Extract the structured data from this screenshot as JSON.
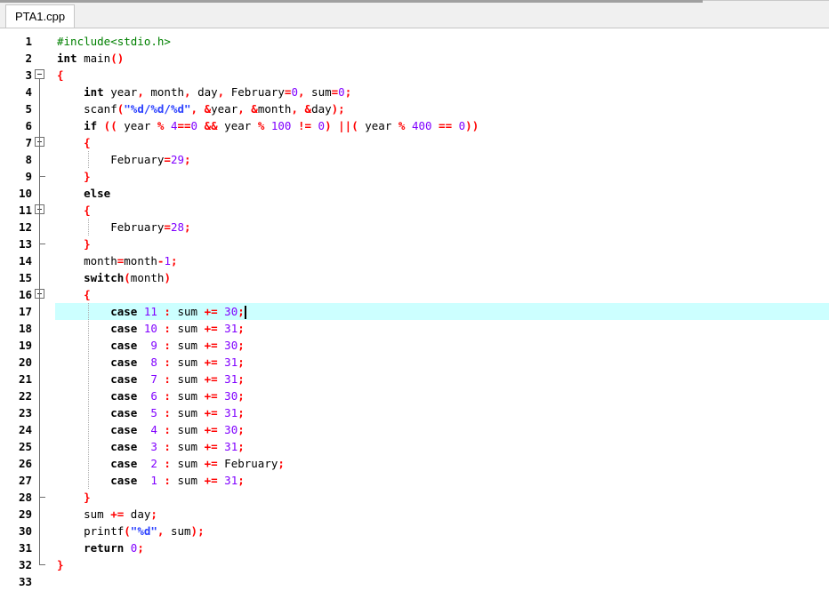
{
  "window": {
    "top_strip": true
  },
  "tab": {
    "label": "PTA1.cpp"
  },
  "editor": {
    "active_line": 17,
    "line_numbers": [
      "1",
      "2",
      "3",
      "4",
      "5",
      "6",
      "7",
      "8",
      "9",
      "10",
      "11",
      "12",
      "13",
      "14",
      "15",
      "16",
      "17",
      "18",
      "19",
      "20",
      "21",
      "22",
      "23",
      "24",
      "25",
      "26",
      "27",
      "28",
      "29",
      "30",
      "31",
      "32",
      "33"
    ],
    "lines": [
      [
        {
          "t": "#include<stdio.h>",
          "c": "pp"
        }
      ],
      [
        {
          "t": "int",
          "c": "kw"
        },
        {
          "t": " main",
          "c": "id"
        },
        {
          "t": "()",
          "c": "op"
        }
      ],
      [
        {
          "t": "{",
          "c": "op"
        }
      ],
      [
        {
          "t": "    int",
          "c": "kw"
        },
        {
          "t": " year",
          "c": "id"
        },
        {
          "t": ",",
          "c": "op"
        },
        {
          "t": " month",
          "c": "id"
        },
        {
          "t": ",",
          "c": "op"
        },
        {
          "t": " day",
          "c": "id"
        },
        {
          "t": ",",
          "c": "op"
        },
        {
          "t": " February",
          "c": "id"
        },
        {
          "t": "=",
          "c": "op"
        },
        {
          "t": "0",
          "c": "num"
        },
        {
          "t": ",",
          "c": "op"
        },
        {
          "t": " sum",
          "c": "id"
        },
        {
          "t": "=",
          "c": "op"
        },
        {
          "t": "0",
          "c": "num"
        },
        {
          "t": ";",
          "c": "op"
        }
      ],
      [
        {
          "t": "    scanf",
          "c": "id"
        },
        {
          "t": "(",
          "c": "op"
        },
        {
          "t": "\"%d/%d/%d\"",
          "c": "str"
        },
        {
          "t": ",",
          "c": "op"
        },
        {
          "t": " ",
          "c": "id"
        },
        {
          "t": "&",
          "c": "op"
        },
        {
          "t": "year",
          "c": "id"
        },
        {
          "t": ",",
          "c": "op"
        },
        {
          "t": " ",
          "c": "id"
        },
        {
          "t": "&",
          "c": "op"
        },
        {
          "t": "month",
          "c": "id"
        },
        {
          "t": ",",
          "c": "op"
        },
        {
          "t": " ",
          "c": "id"
        },
        {
          "t": "&",
          "c": "op"
        },
        {
          "t": "day",
          "c": "id"
        },
        {
          "t": ");",
          "c": "op"
        }
      ],
      [
        {
          "t": "    if",
          "c": "kw"
        },
        {
          "t": " ((",
          "c": "op"
        },
        {
          "t": " year ",
          "c": "id"
        },
        {
          "t": "%",
          "c": "op"
        },
        {
          "t": " 4",
          "c": "num"
        },
        {
          "t": "==",
          "c": "op"
        },
        {
          "t": "0",
          "c": "num"
        },
        {
          "t": " &&",
          "c": "op"
        },
        {
          "t": " year ",
          "c": "id"
        },
        {
          "t": "%",
          "c": "op"
        },
        {
          "t": " 100",
          "c": "num"
        },
        {
          "t": " !=",
          "c": "op"
        },
        {
          "t": " 0",
          "c": "num"
        },
        {
          "t": ")",
          "c": "op"
        },
        {
          "t": " ||(",
          "c": "op"
        },
        {
          "t": " year ",
          "c": "id"
        },
        {
          "t": "%",
          "c": "op"
        },
        {
          "t": " 400",
          "c": "num"
        },
        {
          "t": " ==",
          "c": "op"
        },
        {
          "t": " 0",
          "c": "num"
        },
        {
          "t": "))",
          "c": "op"
        }
      ],
      [
        {
          "t": "    {",
          "c": "op"
        }
      ],
      [
        {
          "t": "        February",
          "c": "id"
        },
        {
          "t": "=",
          "c": "op"
        },
        {
          "t": "29",
          "c": "num"
        },
        {
          "t": ";",
          "c": "op"
        }
      ],
      [
        {
          "t": "    }",
          "c": "op"
        }
      ],
      [
        {
          "t": "    else",
          "c": "kw"
        }
      ],
      [
        {
          "t": "    {",
          "c": "op"
        }
      ],
      [
        {
          "t": "        February",
          "c": "id"
        },
        {
          "t": "=",
          "c": "op"
        },
        {
          "t": "28",
          "c": "num"
        },
        {
          "t": ";",
          "c": "op"
        }
      ],
      [
        {
          "t": "    }",
          "c": "op"
        }
      ],
      [
        {
          "t": "    month",
          "c": "id"
        },
        {
          "t": "=",
          "c": "op"
        },
        {
          "t": "month",
          "c": "id"
        },
        {
          "t": "-",
          "c": "op"
        },
        {
          "t": "1",
          "c": "num"
        },
        {
          "t": ";",
          "c": "op"
        }
      ],
      [
        {
          "t": "    switch",
          "c": "kw"
        },
        {
          "t": "(",
          "c": "op"
        },
        {
          "t": "month",
          "c": "id"
        },
        {
          "t": ")",
          "c": "op"
        }
      ],
      [
        {
          "t": "    {",
          "c": "op"
        }
      ],
      [
        {
          "t": "        case",
          "c": "kw"
        },
        {
          "t": " 11",
          "c": "num"
        },
        {
          "t": " :",
          "c": "op"
        },
        {
          "t": " sum ",
          "c": "id"
        },
        {
          "t": "+=",
          "c": "op"
        },
        {
          "t": " 30",
          "c": "num"
        },
        {
          "t": ";",
          "c": "op"
        }
      ],
      [
        {
          "t": "        case",
          "c": "kw"
        },
        {
          "t": " 10",
          "c": "num"
        },
        {
          "t": " :",
          "c": "op"
        },
        {
          "t": " sum ",
          "c": "id"
        },
        {
          "t": "+=",
          "c": "op"
        },
        {
          "t": " 31",
          "c": "num"
        },
        {
          "t": ";",
          "c": "op"
        }
      ],
      [
        {
          "t": "        case",
          "c": "kw"
        },
        {
          "t": "  9",
          "c": "num"
        },
        {
          "t": " :",
          "c": "op"
        },
        {
          "t": " sum ",
          "c": "id"
        },
        {
          "t": "+=",
          "c": "op"
        },
        {
          "t": " 30",
          "c": "num"
        },
        {
          "t": ";",
          "c": "op"
        }
      ],
      [
        {
          "t": "        case",
          "c": "kw"
        },
        {
          "t": "  8",
          "c": "num"
        },
        {
          "t": " :",
          "c": "op"
        },
        {
          "t": " sum ",
          "c": "id"
        },
        {
          "t": "+=",
          "c": "op"
        },
        {
          "t": " 31",
          "c": "num"
        },
        {
          "t": ";",
          "c": "op"
        }
      ],
      [
        {
          "t": "        case",
          "c": "kw"
        },
        {
          "t": "  7",
          "c": "num"
        },
        {
          "t": " :",
          "c": "op"
        },
        {
          "t": " sum ",
          "c": "id"
        },
        {
          "t": "+=",
          "c": "op"
        },
        {
          "t": " 31",
          "c": "num"
        },
        {
          "t": ";",
          "c": "op"
        }
      ],
      [
        {
          "t": "        case",
          "c": "kw"
        },
        {
          "t": "  6",
          "c": "num"
        },
        {
          "t": " :",
          "c": "op"
        },
        {
          "t": " sum ",
          "c": "id"
        },
        {
          "t": "+=",
          "c": "op"
        },
        {
          "t": " 30",
          "c": "num"
        },
        {
          "t": ";",
          "c": "op"
        }
      ],
      [
        {
          "t": "        case",
          "c": "kw"
        },
        {
          "t": "  5",
          "c": "num"
        },
        {
          "t": " :",
          "c": "op"
        },
        {
          "t": " sum ",
          "c": "id"
        },
        {
          "t": "+=",
          "c": "op"
        },
        {
          "t": " 31",
          "c": "num"
        },
        {
          "t": ";",
          "c": "op"
        }
      ],
      [
        {
          "t": "        case",
          "c": "kw"
        },
        {
          "t": "  4",
          "c": "num"
        },
        {
          "t": " :",
          "c": "op"
        },
        {
          "t": " sum ",
          "c": "id"
        },
        {
          "t": "+=",
          "c": "op"
        },
        {
          "t": " 30",
          "c": "num"
        },
        {
          "t": ";",
          "c": "op"
        }
      ],
      [
        {
          "t": "        case",
          "c": "kw"
        },
        {
          "t": "  3",
          "c": "num"
        },
        {
          "t": " :",
          "c": "op"
        },
        {
          "t": " sum ",
          "c": "id"
        },
        {
          "t": "+=",
          "c": "op"
        },
        {
          "t": " 31",
          "c": "num"
        },
        {
          "t": ";",
          "c": "op"
        }
      ],
      [
        {
          "t": "        case",
          "c": "kw"
        },
        {
          "t": "  2",
          "c": "num"
        },
        {
          "t": " :",
          "c": "op"
        },
        {
          "t": " sum ",
          "c": "id"
        },
        {
          "t": "+=",
          "c": "op"
        },
        {
          "t": " February",
          "c": "id"
        },
        {
          "t": ";",
          "c": "op"
        }
      ],
      [
        {
          "t": "        case",
          "c": "kw"
        },
        {
          "t": "  1",
          "c": "num"
        },
        {
          "t": " :",
          "c": "op"
        },
        {
          "t": " sum ",
          "c": "id"
        },
        {
          "t": "+=",
          "c": "op"
        },
        {
          "t": " 31",
          "c": "num"
        },
        {
          "t": ";",
          "c": "op"
        }
      ],
      [
        {
          "t": "    }",
          "c": "op"
        }
      ],
      [
        {
          "t": "    sum ",
          "c": "id"
        },
        {
          "t": "+=",
          "c": "op"
        },
        {
          "t": " day",
          "c": "id"
        },
        {
          "t": ";",
          "c": "op"
        }
      ],
      [
        {
          "t": "    printf",
          "c": "id"
        },
        {
          "t": "(",
          "c": "op"
        },
        {
          "t": "\"%d\"",
          "c": "str"
        },
        {
          "t": ",",
          "c": "op"
        },
        {
          "t": " sum",
          "c": "id"
        },
        {
          "t": ");",
          "c": "op"
        }
      ],
      [
        {
          "t": "    return",
          "c": "kw"
        },
        {
          "t": " 0",
          "c": "num"
        },
        {
          "t": ";",
          "c": "op"
        }
      ],
      [
        {
          "t": "}",
          "c": "op"
        }
      ],
      []
    ],
    "fold_open_lines": [
      3,
      7,
      11,
      16
    ],
    "fold_end_lines": [
      9,
      13,
      28,
      32
    ],
    "colors": {
      "active_line_bg": "#ccffff",
      "keyword": "#000000",
      "preprocessor": "#008000",
      "operator": "#ff0000",
      "number": "#8000ff",
      "string": "#2a40ff"
    }
  }
}
